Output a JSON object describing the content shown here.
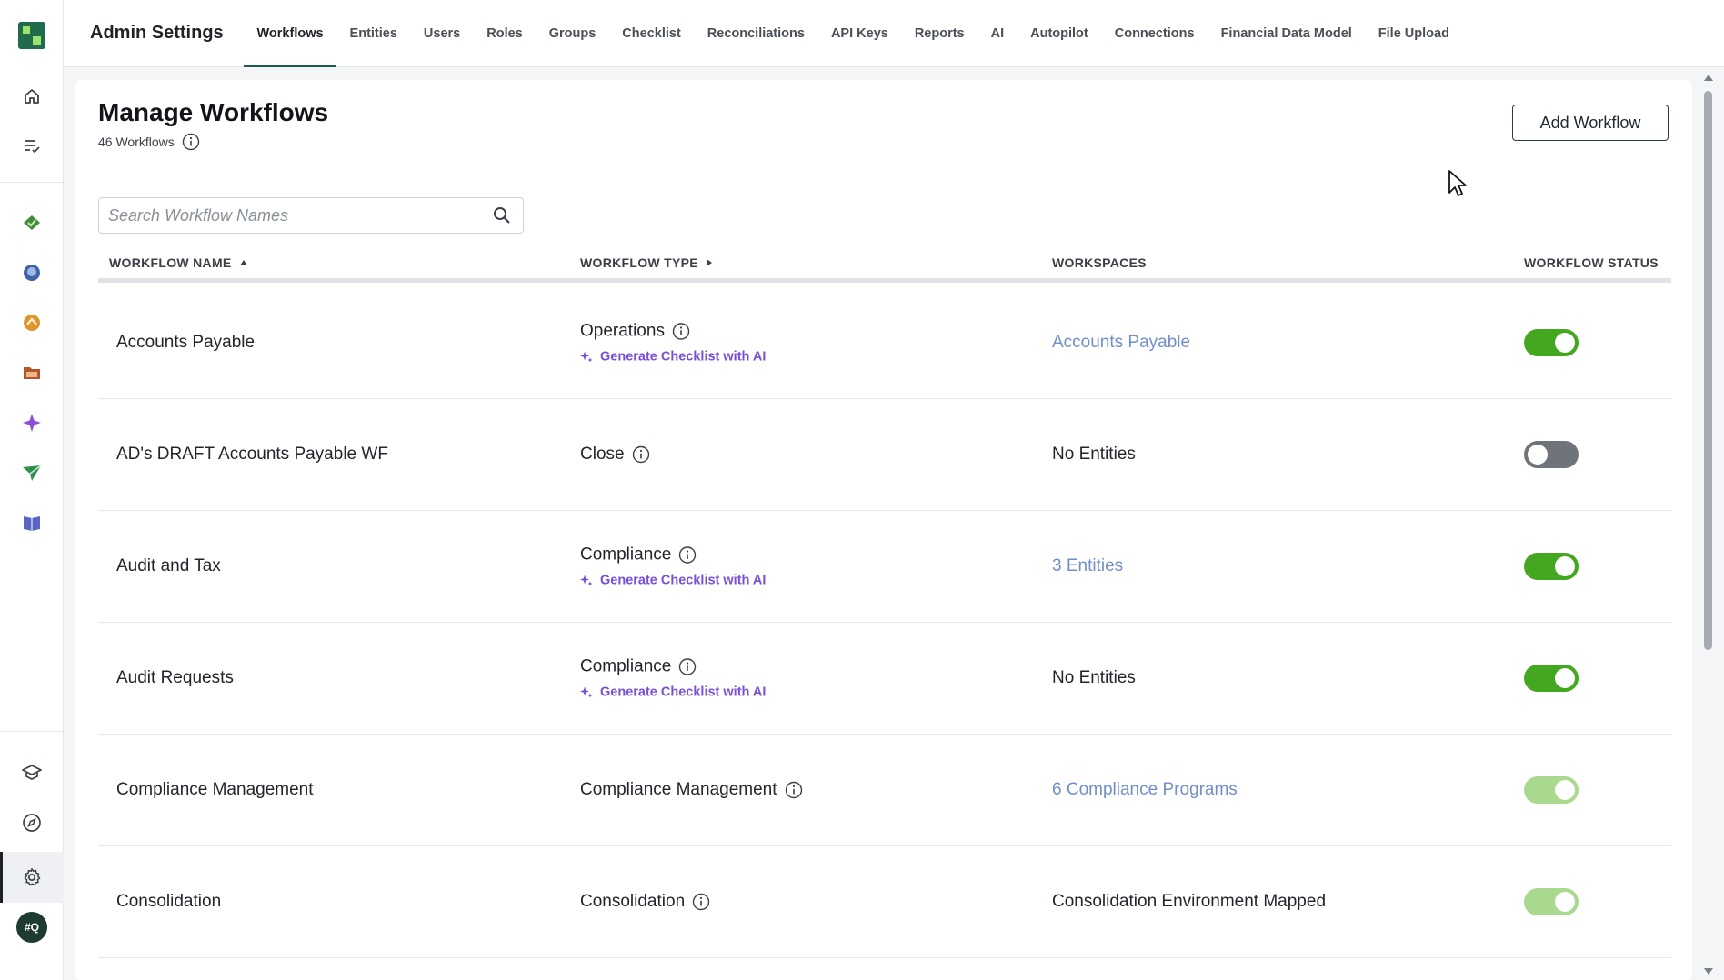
{
  "header": {
    "app_title": "Admin Settings",
    "tabs": [
      {
        "label": "Workflows",
        "active": true
      },
      {
        "label": "Entities"
      },
      {
        "label": "Users"
      },
      {
        "label": "Roles"
      },
      {
        "label": "Groups"
      },
      {
        "label": "Checklist"
      },
      {
        "label": "Reconciliations"
      },
      {
        "label": "API Keys"
      },
      {
        "label": "Reports"
      },
      {
        "label": "AI"
      },
      {
        "label": "Autopilot"
      },
      {
        "label": "Connections"
      },
      {
        "label": "Financial Data Model"
      },
      {
        "label": "File Upload"
      }
    ]
  },
  "sidebar": {
    "top_icons": [
      "home-icon",
      "tasks-list-icon"
    ],
    "module_icons": [
      "checklist-module-icon",
      "reconciliation-module-icon",
      "flux-module-icon",
      "documents-folder-icon",
      "ai-sparkle-icon",
      "send-plane-icon",
      "guide-book-icon"
    ],
    "bottom_icons": [
      "learning-hat-icon",
      "compass-icon",
      "settings-gear-icon"
    ],
    "avatar_initials": "#Q"
  },
  "main": {
    "title": "Manage Workflows",
    "count_label": "46 Workflows",
    "add_button_label": "Add Workflow",
    "search": {
      "placeholder": "Search Workflow Names",
      "value": ""
    },
    "columns": {
      "name": "WORKFLOW NAME",
      "type": "WORKFLOW TYPE",
      "workspaces": "WORKSPACES",
      "status": "WORKFLOW STATUS"
    },
    "ai_link_label": "Generate Checklist with AI",
    "rows": [
      {
        "name": "Accounts Payable",
        "type": "Operations",
        "ai": true,
        "workspaces": "Accounts Payable",
        "ws_link": true,
        "status": "on"
      },
      {
        "name": "AD's DRAFT Accounts Payable WF",
        "type": "Close",
        "ai": false,
        "workspaces": "No Entities",
        "ws_link": false,
        "status": "off"
      },
      {
        "name": "Audit and Tax",
        "type": "Compliance",
        "ai": true,
        "workspaces": "3 Entities",
        "ws_link": true,
        "status": "on"
      },
      {
        "name": "Audit Requests",
        "type": "Compliance",
        "ai": true,
        "workspaces": "No Entities",
        "ws_link": false,
        "status": "on"
      },
      {
        "name": "Compliance Management",
        "type": "Compliance Management",
        "ai": false,
        "workspaces": "6 Compliance Programs",
        "ws_link": true,
        "status": "on-disabled"
      },
      {
        "name": "Consolidation",
        "type": "Consolidation",
        "ai": false,
        "workspaces": "Consolidation Environment Mapped",
        "ws_link": false,
        "status": "on-disabled"
      }
    ]
  },
  "colors": {
    "brand_green": "#1b5e50",
    "toggle_on": "#43a81f",
    "toggle_on_disabled": "#a9d98e",
    "toggle_off": "#6f747b",
    "link_blue": "#6f8fc9",
    "ai_purple": "#7a4fd6"
  }
}
